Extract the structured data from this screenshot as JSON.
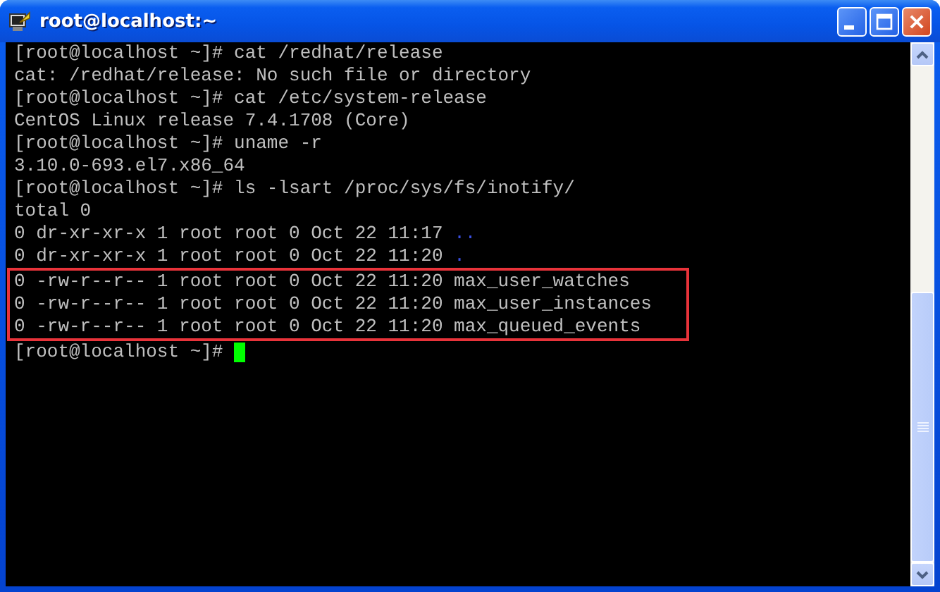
{
  "window": {
    "title": "root@localhost:~"
  },
  "terminal": {
    "lines": [
      {
        "text": "[root@localhost ~]# cat /redhat/release",
        "highlighted": false
      },
      {
        "text": "cat: /redhat/release: No such file or directory",
        "highlighted": false
      },
      {
        "text": "[root@localhost ~]# cat /etc/system-release",
        "highlighted": false
      },
      {
        "text": "CentOS Linux release 7.4.1708 (Core)",
        "highlighted": false
      },
      {
        "text": "[root@localhost ~]# uname -r",
        "highlighted": false
      },
      {
        "text": "3.10.0-693.el7.x86_64",
        "highlighted": false
      },
      {
        "text": "[root@localhost ~]# ls -lsart /proc/sys/fs/inotify/",
        "highlighted": false
      },
      {
        "text": "total 0",
        "highlighted": false
      },
      {
        "text": "0 dr-xr-xr-x 1 root root 0 Oct 22 11:17",
        "dir": "..",
        "highlighted": false
      },
      {
        "text": "0 dr-xr-xr-x 1 root root 0 Oct 22 11:20",
        "dir": ".",
        "highlighted": false
      },
      {
        "text": "0 -rw-r--r-- 1 root root 0 Oct 22 11:20 max_user_watches",
        "highlighted": true
      },
      {
        "text": "0 -rw-r--r-- 1 root root 0 Oct 22 11:20 max_user_instances",
        "highlighted": true
      },
      {
        "text": "0 -rw-r--r-- 1 root root 0 Oct 22 11:20 max_queued_events",
        "highlighted": true
      },
      {
        "text": "[root@localhost ~]#",
        "highlighted": false,
        "cursor": true
      }
    ]
  }
}
